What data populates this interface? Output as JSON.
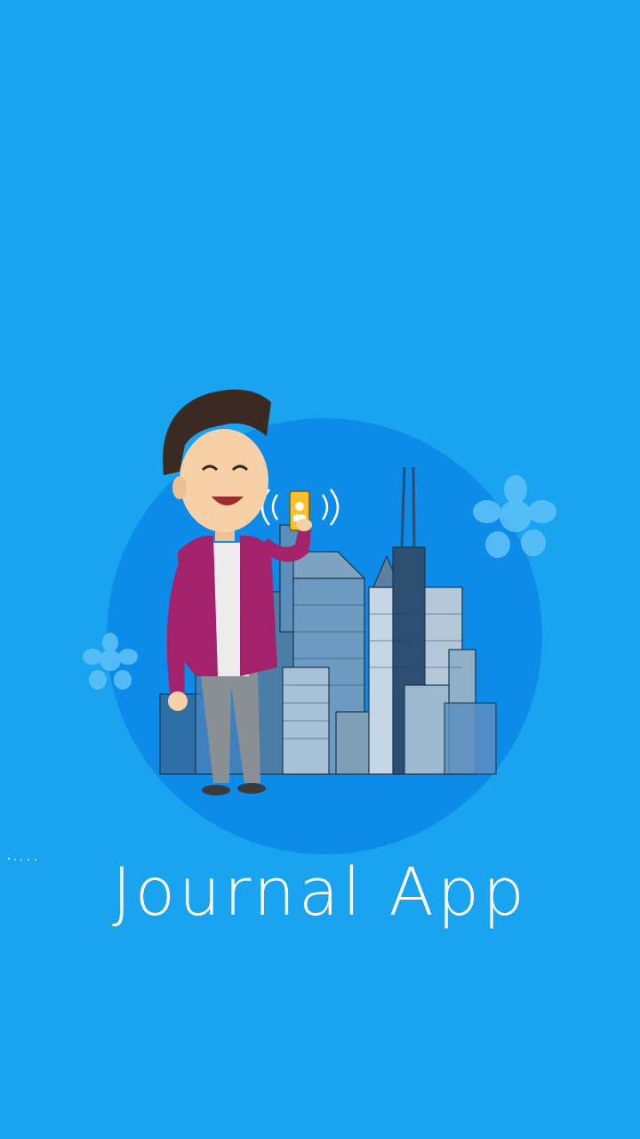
{
  "app": {
    "title": "Journal App"
  },
  "illustration": {
    "subject": "person-with-phone-city-icon"
  },
  "colors": {
    "background": "#1aa3ef",
    "circle": "#0d8be8",
    "jacket": "#a3226a",
    "accent_phone": "#f6c12b"
  }
}
